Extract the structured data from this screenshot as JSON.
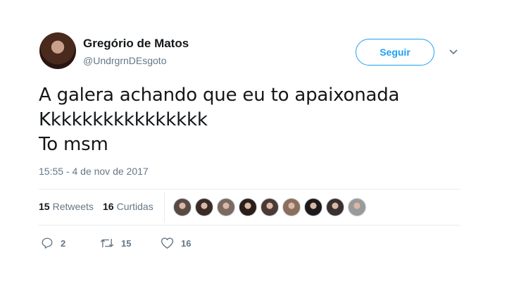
{
  "author": {
    "name": "Gregório de Matos",
    "handle": "@UndrgrnDEsgoto"
  },
  "follow_label": "Seguir",
  "tweet": {
    "text": "A galera achando que eu to apaixonada\nKkkkkkkkkkkkkkkk\nTo msm",
    "timestamp": "15:55 - 4 de nov de 2017"
  },
  "stats": {
    "retweets_count": "15",
    "retweets_label": "Retweets",
    "likes_count": "16",
    "likes_label": "Curtidas"
  },
  "likers": [
    {
      "color": "#5a4a44"
    },
    {
      "color": "#3b2b25"
    },
    {
      "color": "#7a6a60"
    },
    {
      "color": "#2a1e1a"
    },
    {
      "color": "#4b3a33"
    },
    {
      "color": "#8c6e5c"
    },
    {
      "color": "#1e1a1a"
    },
    {
      "color": "#3a3030"
    },
    {
      "color": "#9a9a9a"
    }
  ],
  "actions": {
    "reply_count": "2",
    "retweet_count": "15",
    "like_count": "16"
  },
  "colors": {
    "accent": "#1da1f2",
    "secondary_text": "#657786",
    "divider": "#e6ecf0"
  }
}
